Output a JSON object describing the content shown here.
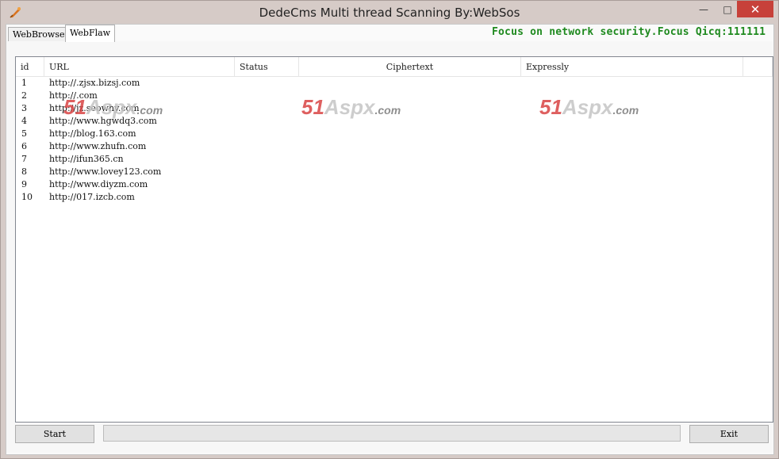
{
  "window": {
    "title": "DedeCms Multi thread Scanning By:WebSos",
    "controls": {
      "minimize": "—",
      "maximize": "□",
      "close": "✕"
    }
  },
  "tabs": [
    {
      "label": "WebBrowser",
      "selected": false
    },
    {
      "label": "WebFlaw",
      "selected": true
    }
  ],
  "banner": "Focus on network security.Focus Qicq:111111",
  "table": {
    "columns": [
      "id",
      "URL",
      "Status",
      "Ciphertext",
      "Expressly"
    ],
    "rows": [
      {
        "id": "1",
        "url": "http://.zjsx.bizsj.com"
      },
      {
        "id": "2",
        "url": "http://.com"
      },
      {
        "id": "3",
        "url": "http://jz.seowhy.com"
      },
      {
        "id": "4",
        "url": "http://www.hgwdq3.com"
      },
      {
        "id": "5",
        "url": "http://blog.163.com"
      },
      {
        "id": "6",
        "url": "http://www.zhufn.com"
      },
      {
        "id": "7",
        "url": "http://ifun365.cn"
      },
      {
        "id": "8",
        "url": "http://www.lovey123.com"
      },
      {
        "id": "9",
        "url": "http://www.diyzm.com"
      },
      {
        "id": "10",
        "url": "http://017.izcb.com"
      }
    ]
  },
  "watermark": {
    "num": "51",
    "brand": "Aspx",
    "suffix": ".com"
  },
  "buttons": {
    "start": "Start",
    "exit": "Exit"
  },
  "progress": {
    "value": 0
  },
  "colors": {
    "banner": "#1f8a1f",
    "close_button": "#c7413a",
    "watermark_red": "#d94444"
  }
}
